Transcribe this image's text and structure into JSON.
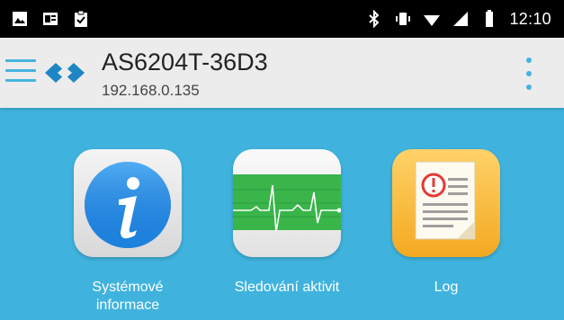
{
  "status_bar": {
    "time": "12:10",
    "icons": [
      "image-icon",
      "mail-icon",
      "clipboard-check-icon",
      "bluetooth-icon",
      "vibrate-icon",
      "wifi-icon",
      "cell-signal-icon",
      "battery-icon"
    ]
  },
  "app_bar": {
    "title": "AS6204T-36D3",
    "subtitle": "192.168.0.135",
    "accent_color": "#46b3dd"
  },
  "launcher": {
    "background_color": "#3fb3de",
    "items": [
      {
        "label": "Systémové informace",
        "icon": "info-icon"
      },
      {
        "label": "Sledování aktivit",
        "icon": "heartbeat-monitor-icon"
      },
      {
        "label": "Log",
        "icon": "log-document-icon"
      }
    ]
  }
}
